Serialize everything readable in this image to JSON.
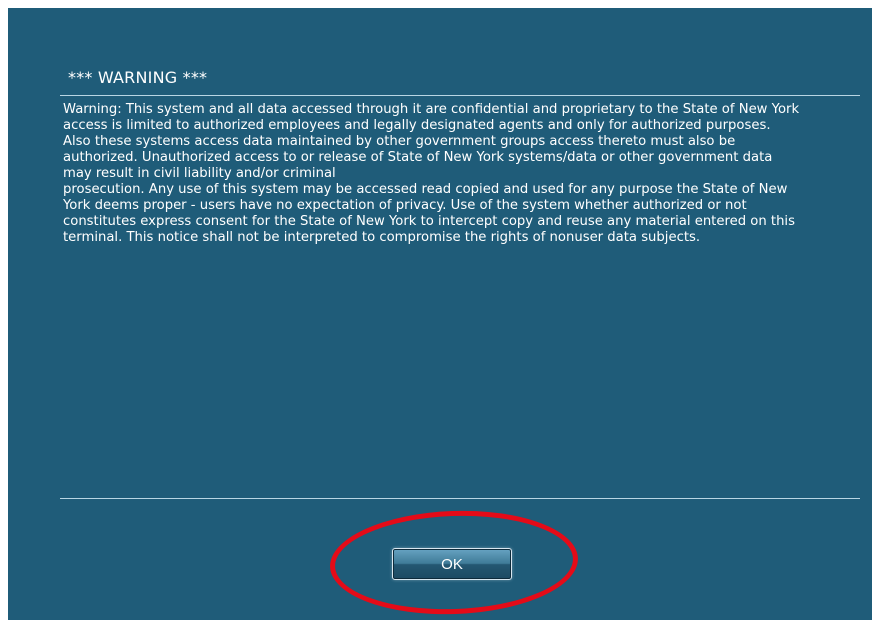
{
  "dialog": {
    "title": "*** WARNING ***",
    "message": "Warning: This system and all data accessed through it are confidential and proprietary to the State of New York\naccess is limited to authorized employees and legally designated agents and only for authorized purposes.\nAlso these systems access data maintained by other government groups access thereto must also be\nauthorized.  Unauthorized access to or release of State of New York systems/data or other government data\nmay result in civil liability and/or criminal\nprosecution. Any use of this system may be accessed read copied and used for any purpose the State of New\nYork deems proper - users have no expectation of privacy.  Use of the system whether authorized or not\nconstitutes express consent for the State of New York to intercept copy and reuse any material entered on this\nterminal.  This notice shall not be interpreted to compromise the rights of nonuser data subjects.",
    "ok_label": "OK"
  },
  "colors": {
    "background": "#1f5c79",
    "text": "#ffffff",
    "annotation": "#e40b18"
  }
}
